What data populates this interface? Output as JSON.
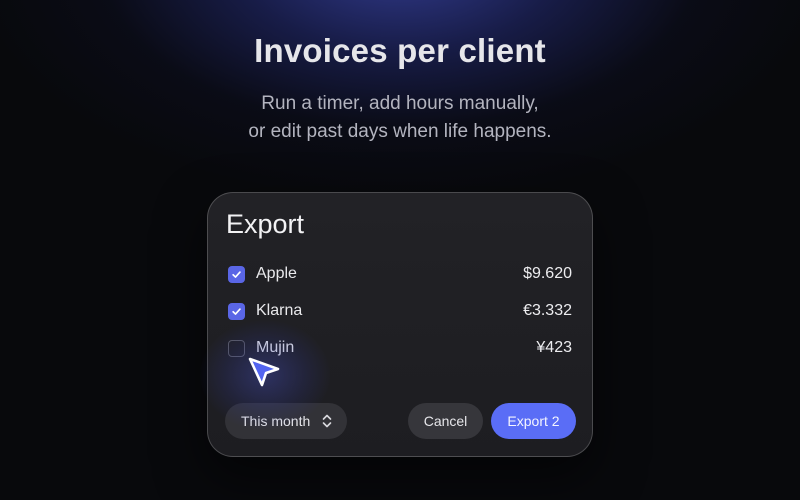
{
  "hero": {
    "title": "Invoices per client",
    "subtitle_line1": "Run a timer, add hours manually,",
    "subtitle_line2": "or edit past days when life happens."
  },
  "dialog": {
    "title": "Export",
    "clients": [
      {
        "name": "Apple",
        "amount": "$9.620",
        "checked": true
      },
      {
        "name": "Klarna",
        "amount": "€3.332",
        "checked": true
      },
      {
        "name": "Mujin",
        "amount": "¥423",
        "checked": false
      }
    ],
    "period_select": {
      "value": "This month",
      "icon": "chevron-up-down-icon"
    },
    "cancel_label": "Cancel",
    "export_label": "Export 2"
  },
  "colors": {
    "accent": "#5a6df6",
    "checkbox": "#5a66e6",
    "background": "#08090c",
    "dialog": "#1f1f23"
  },
  "cursor": {
    "icon": "pointer-arrow-icon"
  }
}
